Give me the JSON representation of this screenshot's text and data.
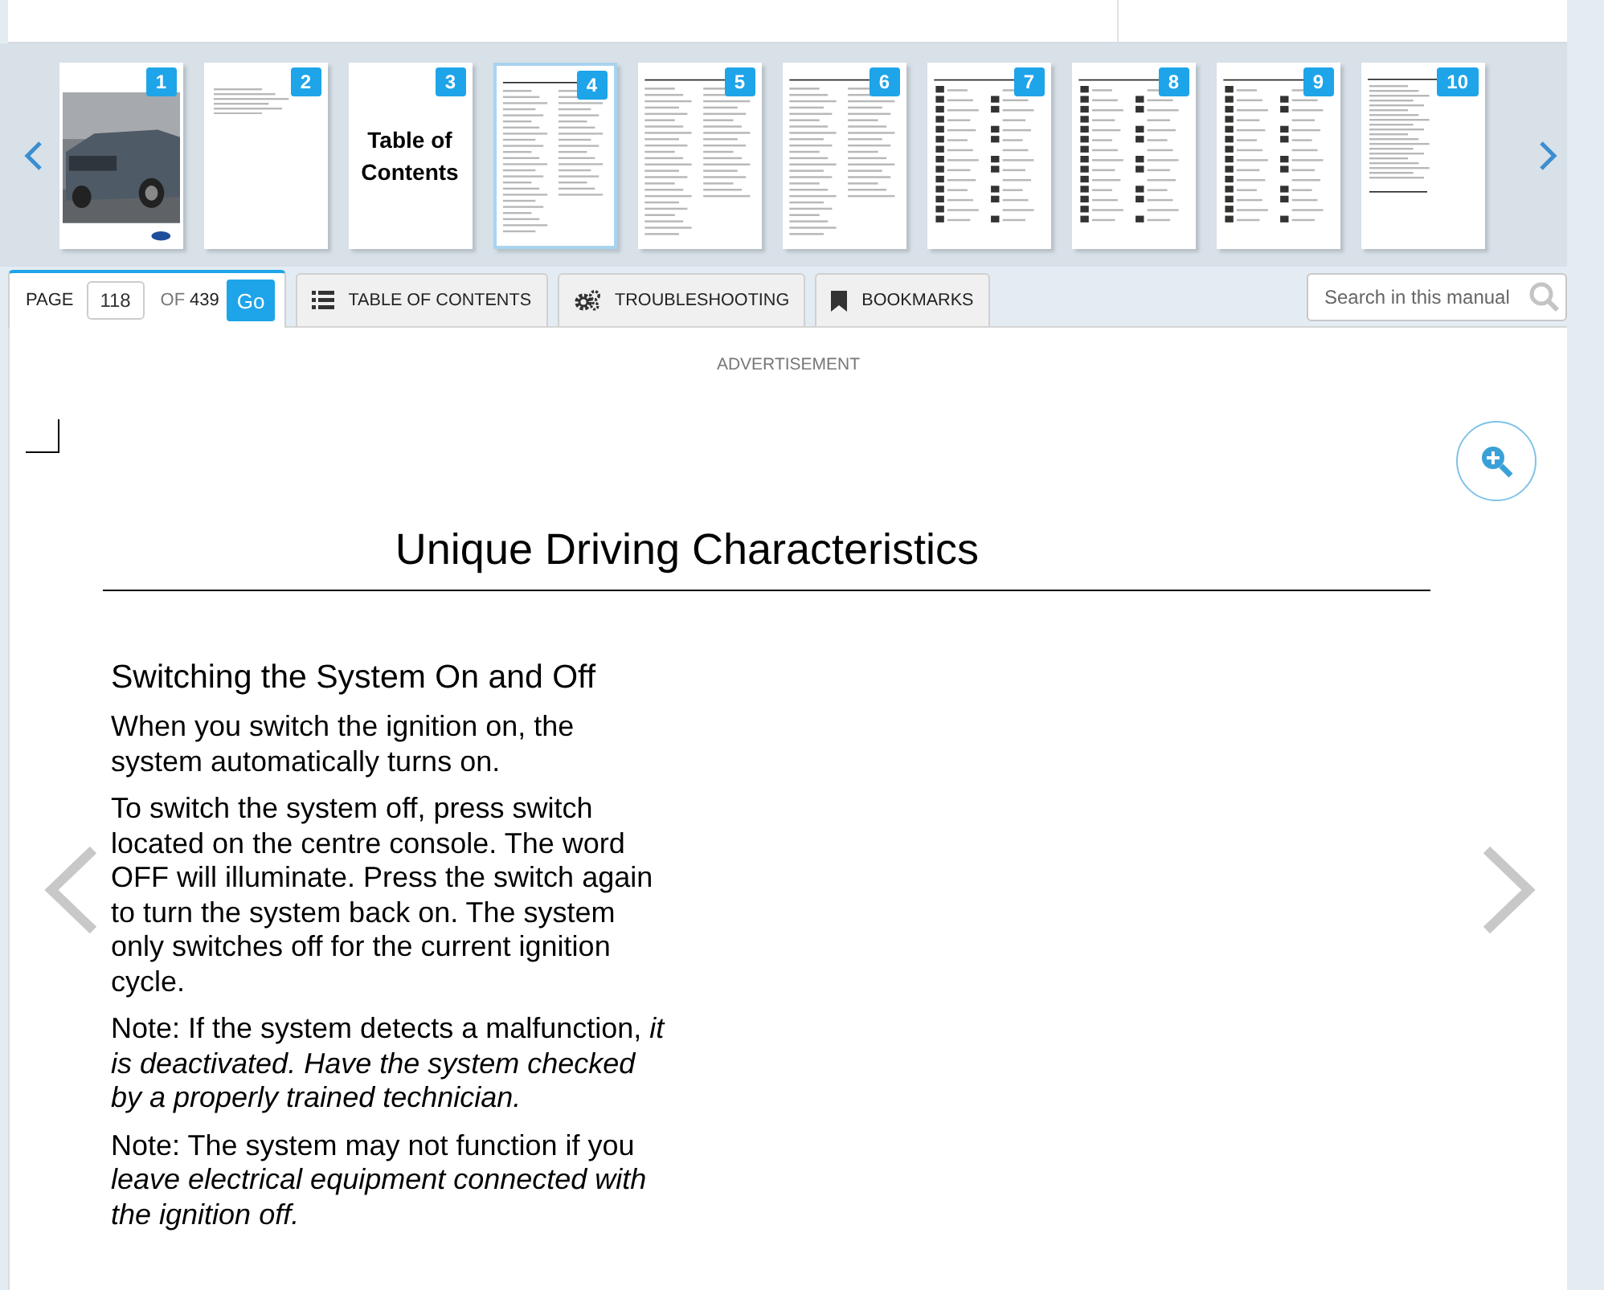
{
  "thumbnails": [
    {
      "number": "1",
      "kind": "cover",
      "selected": false
    },
    {
      "number": "2",
      "kind": "notes",
      "selected": false
    },
    {
      "number": "3",
      "kind": "title",
      "title": "Table of Contents",
      "selected": false
    },
    {
      "number": "4",
      "kind": "toc",
      "selected": true
    },
    {
      "number": "5",
      "kind": "toc",
      "selected": false
    },
    {
      "number": "6",
      "kind": "toc",
      "selected": false
    },
    {
      "number": "7",
      "kind": "icons",
      "selected": false
    },
    {
      "number": "8",
      "kind": "icons",
      "selected": false
    },
    {
      "number": "9",
      "kind": "icons",
      "selected": false
    },
    {
      "number": "10",
      "kind": "text",
      "selected": false
    }
  ],
  "tabs": [
    {
      "kind": "page",
      "label": "PAGE",
      "value": "118",
      "of": "OF",
      "total": "439",
      "button": "Go",
      "selected": true
    },
    {
      "kind": "toc",
      "label": "TABLE OF CONTENTS",
      "selected": false
    },
    {
      "kind": "troubleshooting",
      "label": "TROUBLESHOOTING",
      "selected": false
    },
    {
      "kind": "bookmarks",
      "label": "BOOKMARKS",
      "selected": false
    }
  ],
  "search": {
    "placeholder": "Search in this manual"
  },
  "advertisement": "ADVERTISEMENT",
  "document": {
    "title": "Unique Driving Characteristics",
    "section": "Switching the System On and Off",
    "paragraphs": [
      "When you switch the ignition on, the system automatically turns on.",
      "To switch the system off, press switch located on the centre console. The word OFF will illuminate. Press the switch again to turn the system back on. The system only switches off for the current ignition cycle.",
      "Note: If the system detects a malfunction, *it is deactivated. Have the system checked by a properly trained technician.*",
      "Note: The system may not function if you *leave electrical equipment connected with the ignition off.*"
    ]
  }
}
